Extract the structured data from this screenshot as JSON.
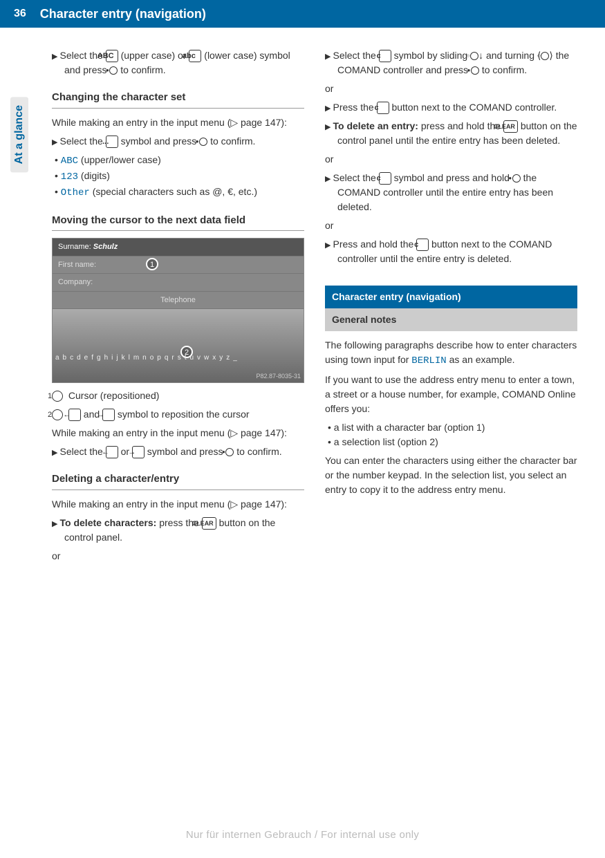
{
  "header": {
    "page_number": "36",
    "title": "Character entry (navigation)"
  },
  "side_tab": "At a glance",
  "col1": {
    "intro_step": {
      "pre": "Select the ",
      "key1": "ABC",
      "mid1": " (upper case) or ",
      "key2": "abc",
      "mid2": " (lower case) symbol and press ",
      "post": " to confirm."
    },
    "h1": "Changing the character set",
    "h1_intro": "While making an entry in the input menu (▷ page 147):",
    "h1_step": {
      "pre": "Select the ",
      "key": "...",
      "mid": " symbol and press ",
      "post": " to confirm."
    },
    "charset_list": [
      {
        "code": "ABC",
        "label": " (upper/lower case)"
      },
      {
        "code": "123",
        "label": " (digits)"
      },
      {
        "code": "Other",
        "label": " (special characters such as @, €, etc.)"
      }
    ],
    "h2": "Moving the cursor to the next data field",
    "image": {
      "row1": "Surname:",
      "row1_val": "Schulz",
      "row2": "First name:",
      "row3": "Company:",
      "row4": "Telephone",
      "kbd": "abcdefghijklmnopqrstuvwxyz_",
      "caption": "P82.87-8035-31"
    },
    "legend": [
      {
        "num": "1",
        "text": "Cursor (repositioned)"
      },
      {
        "num": "2",
        "pre": "",
        "k1": "←",
        "mid": " and ",
        "k2": "→",
        "post": " symbol to reposition the cursor"
      }
    ],
    "h2_intro": "While making an entry in the input menu (▷ page 147):",
    "h2_step": {
      "pre": "Select the ",
      "k1": "←",
      "mid": " or ",
      "k2": "→",
      "mid2": " symbol and press ",
      "post": " to confirm."
    },
    "h3": "Deleting a character/entry",
    "h3_intro": "While making an entry in the input menu (▷ page 147):",
    "h3_step": {
      "bold": "To delete characters:",
      "pre": " press the ",
      "key": "CLEAR",
      "post": " button on the control panel."
    },
    "or": "or"
  },
  "col2": {
    "step1": {
      "pre": "Select the ",
      "key": "c",
      "mid": " symbol by sliding ",
      "mid2": " and turning ",
      "mid3": " the COMAND controller and press ",
      "post": " to confirm."
    },
    "or": "or",
    "step2": {
      "pre": "Press the ",
      "key": "c",
      "post": " button next to the COMAND controller."
    },
    "step3": {
      "bold": "To delete an entry:",
      "pre": " press and hold the ",
      "key": "CLEAR",
      "post": " button on the control panel until the entire entry has been deleted."
    },
    "step4": {
      "pre": "Select the ",
      "key": "c",
      "mid": " symbol and press and hold ",
      "post": " the COMAND controller until the entire entry has been deleted."
    },
    "step5": {
      "pre": "Press and hold the ",
      "key": "c",
      "post": " button next to the COMAND controller until the entire entry is deleted."
    },
    "box1": "Character entry (navigation)",
    "box2": "General notes",
    "p1a": "The following paragraphs describe how to enter characters using town input for ",
    "p1code": "BERLIN",
    "p1b": " as an example.",
    "p2": "If you want to use the address entry menu to enter a town, a street or a house number, for example, COMAND Online offers you:",
    "options": [
      "a list with a character bar (option 1)",
      "a selection list (option 2)"
    ],
    "p3": "You can enter the characters using either the character bar or the number keypad. In the selection list, you select an entry to copy it to the address entry menu."
  },
  "footer": "Nur für internen Gebrauch / For internal use only"
}
